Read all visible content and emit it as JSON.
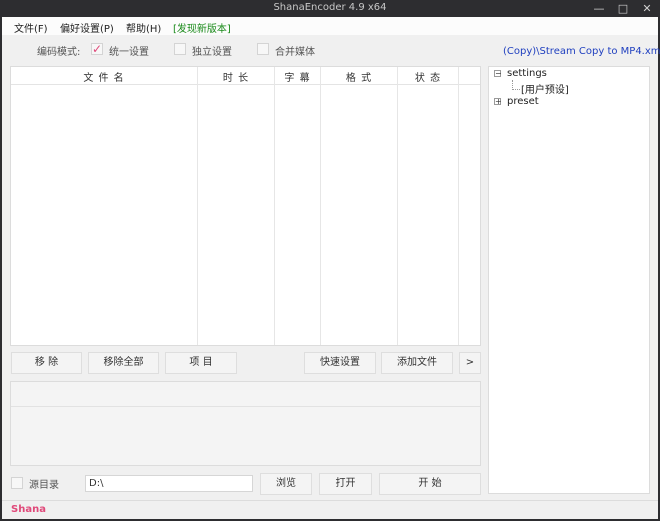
{
  "window": {
    "title": "ShanaEncoder 4.9 x64",
    "minimize": "—",
    "maximize": "□",
    "close": "✕"
  },
  "menu": {
    "file": "文件(F)",
    "prefs": "偏好设置(P)",
    "help": "帮助(H)",
    "new_version": "[发现新版本]"
  },
  "encode": {
    "mode_label": "编码模式:",
    "unified": "统一设置",
    "independent": "独立设置",
    "merge": "合并媒体",
    "unified_checked": true,
    "preset_link": "(Copy)\\Stream Copy to MP4.xml"
  },
  "grid": {
    "columns": [
      "文 件 名",
      "时 长",
      "字 幕",
      "格 式",
      "状 态"
    ],
    "rows": []
  },
  "buttons": {
    "remove": "移 除",
    "remove_all": "移除全部",
    "item": "项 目",
    "quick_settings": "快速设置",
    "add_file": "添加文件",
    "more": ">",
    "browse": "浏览",
    "open": "打开",
    "start": "开 始"
  },
  "bottom": {
    "source_dir_label": "源目录",
    "output_path": "D:\\"
  },
  "tree": {
    "settings": "settings",
    "user_preset": "[用户预设]",
    "preset": "preset"
  },
  "status_bar": {
    "brand": "Shana"
  },
  "colors": {
    "accent": "#e0497a",
    "link": "#1f3fbf",
    "new_version": "#1a8a1a"
  }
}
